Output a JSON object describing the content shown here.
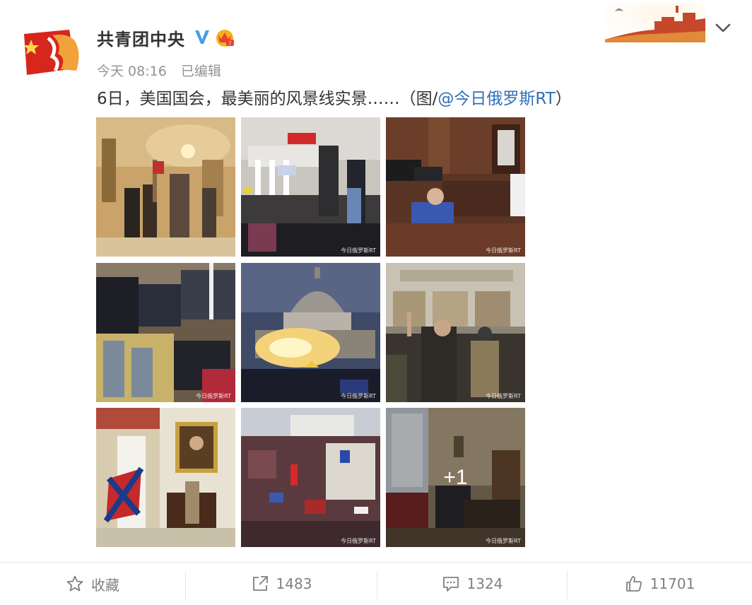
{
  "account": {
    "name": "共青团中央",
    "time": "今天 08:16",
    "edited_label": "已编辑"
  },
  "post": {
    "text": "6日，美国国会，最美丽的风景线实景……（图/",
    "mention": "@今日俄罗斯RT",
    "text_end": "）"
  },
  "images": {
    "watermark": "今日俄罗斯RT",
    "more_count": "+1"
  },
  "actions": {
    "favorite_label": "收藏",
    "repost_count": "1483",
    "comment_count": "1324",
    "like_count": "11701"
  },
  "colors": {
    "link": "#2f6fb5",
    "verified": "#4a9de6",
    "muted": "#939393"
  },
  "icons": [
    "star-icon",
    "share-icon",
    "comment-icon",
    "thumbs-up-icon",
    "chevron-down-icon",
    "verified-icon",
    "crown-icon"
  ]
}
